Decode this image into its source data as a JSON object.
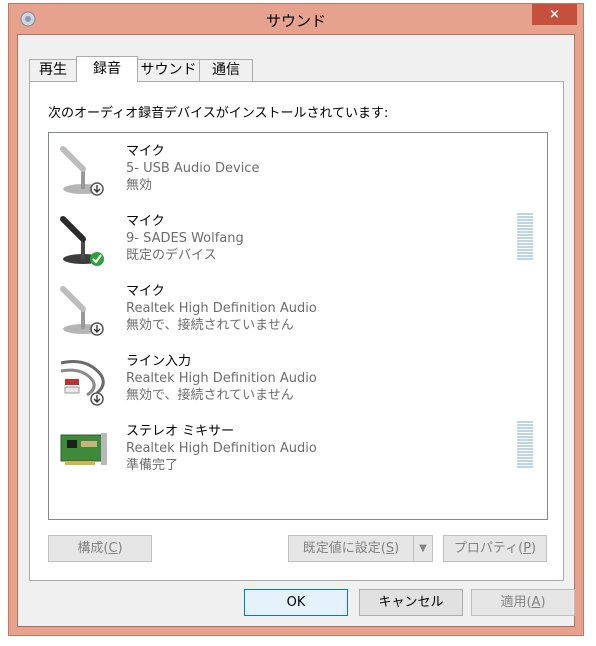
{
  "window": {
    "title": "サウンド",
    "close_label": "×"
  },
  "tabs": [
    {
      "label": "再生",
      "active": false
    },
    {
      "label": "録音",
      "active": true
    },
    {
      "label": "サウンド",
      "active": false
    },
    {
      "label": "通信",
      "active": false
    }
  ],
  "panel": {
    "heading": "次のオーディオ録音デバイスがインストールされています:"
  },
  "devices": [
    {
      "name": "マイク",
      "desc": "5- USB Audio Device",
      "status": "無効",
      "icon": "microphone-icon",
      "badge": "disabled-badge-icon",
      "meter": false
    },
    {
      "name": "マイク",
      "desc": "9- SADES Wolfang",
      "status": "既定のデバイス",
      "icon": "microphone-icon",
      "badge": "default-checkmark-icon",
      "meter": true
    },
    {
      "name": "マイク",
      "desc": "Realtek High Definition Audio",
      "status": "無効で、接続されていません",
      "icon": "microphone-icon",
      "badge": "disabled-badge-icon",
      "meter": false
    },
    {
      "name": "ライン入力",
      "desc": "Realtek High Definition Audio",
      "status": "無効で、接続されていません",
      "icon": "line-in-cable-icon",
      "badge": "disabled-badge-icon",
      "meter": false
    },
    {
      "name": "ステレオ ミキサー",
      "desc": "Realtek High Definition Audio",
      "status": "準備完了",
      "icon": "sound-card-icon",
      "badge": "",
      "meter": true
    }
  ],
  "buttons": {
    "configure": {
      "label": "構成(",
      "key": "C",
      "suffix": ")"
    },
    "set_default": {
      "label": "既定値に設定(",
      "key": "S",
      "suffix": ")"
    },
    "properties": {
      "label": "プロパティ(",
      "key": "P",
      "suffix": ")"
    },
    "ok": "OK",
    "cancel": "キャンセル",
    "apply": {
      "label": "適用(",
      "key": "A",
      "suffix": ")"
    }
  },
  "colors": {
    "frame": "#e7a28e",
    "close": "#c7503d",
    "meter": "#bcd4e6",
    "check": "#2aa33a"
  }
}
